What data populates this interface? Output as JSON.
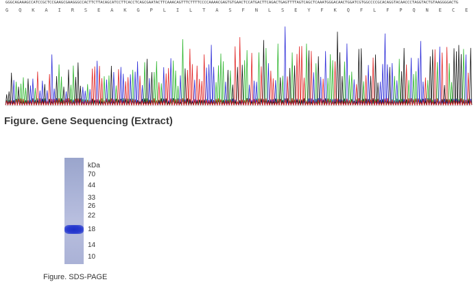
{
  "sequence": {
    "dna": "GGGCAGAAAGCCATCCGCTCCGAAGCGAAGGGCCACTTCTTACAGCATCCTTCACCTCAGCGAATACTTCAAACAGTTTCTTTTCCCCAAAACGAGTGTGAACTCCATGACTTCAGACTGAGTTTTAGTCAGCTCAAATGGGACAACTGGATCGTGGCCCCGCACAGGTACAACCCTAGGTACTGTAAGGGGACTG",
    "protein": "G Q K A I R S E A K G P L I L T A S F N L S E Y F K Q F L F P Q N E C E L H D F R L S F S Q L K W D N W I V A P H R Y N P R Y C K G D C"
  },
  "figure1": {
    "caption": "Figure. Gene Sequencing (Extract)"
  },
  "gel": {
    "unit": "kDa",
    "markers": [
      "70",
      "44",
      "33",
      "26",
      "22",
      "18",
      "14",
      "10"
    ],
    "caption": "Figure. SDS-PAGE"
  },
  "colors": {
    "A": "#2bb52b",
    "C": "#2b2bd8",
    "G": "#111111",
    "T": "#e02020"
  }
}
